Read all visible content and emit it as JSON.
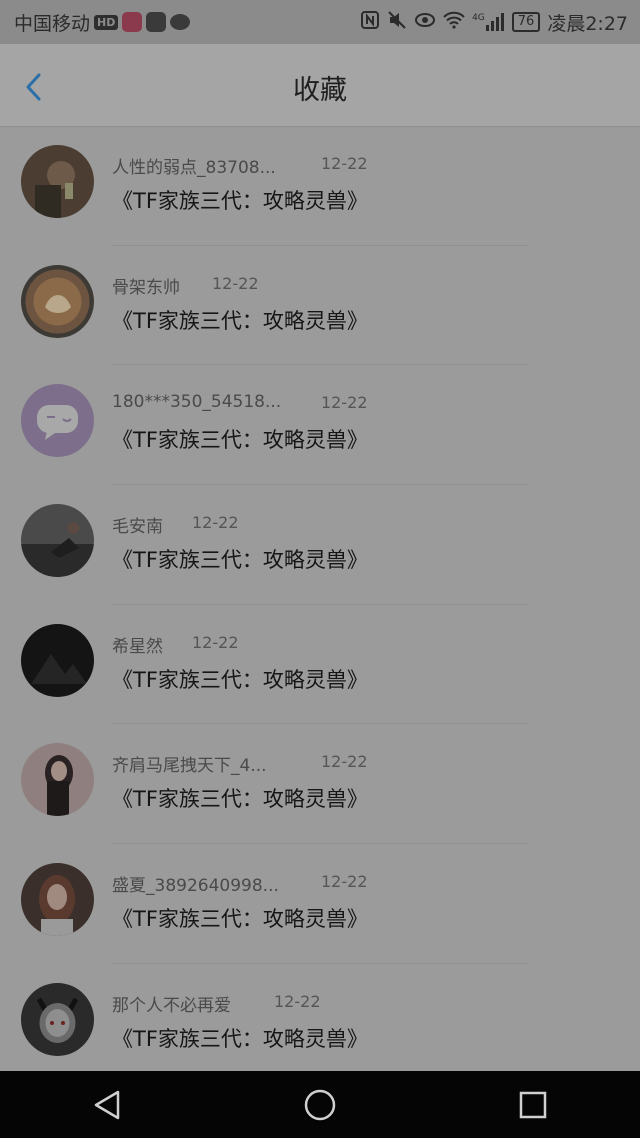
{
  "status_bar": {
    "carrier": "中国移动",
    "hd": "HD",
    "battery": "76",
    "time": "凌晨2:27",
    "network": "4G"
  },
  "header": {
    "title": "收藏"
  },
  "items": [
    {
      "name": "人性的弱点_83708...",
      "date": "12-22",
      "title": "《TF家族三代：攻略灵兽》"
    },
    {
      "name": "骨架东帅",
      "date": "12-22",
      "title": "《TF家族三代：攻略灵兽》"
    },
    {
      "name": "180***350_54518...",
      "date": "12-22",
      "title": "《TF家族三代：攻略灵兽》"
    },
    {
      "name": "毛安南",
      "date": "12-22",
      "title": "《TF家族三代：攻略灵兽》"
    },
    {
      "name": "希星然",
      "date": "12-22",
      "title": "《TF家族三代：攻略灵兽》"
    },
    {
      "name": "齐肩马尾拽天下_4...",
      "date": "12-22",
      "title": "《TF家族三代：攻略灵兽》"
    },
    {
      "name": "盛夏_3892640998...",
      "date": "12-22",
      "title": "《TF家族三代：攻略灵兽》"
    },
    {
      "name": "那个人不必再爱",
      "date": "12-22",
      "title": "《TF家族三代：攻略灵兽》"
    }
  ],
  "colors": {
    "accent": "#2a6fa8",
    "overlay": "#9b9b9b"
  }
}
